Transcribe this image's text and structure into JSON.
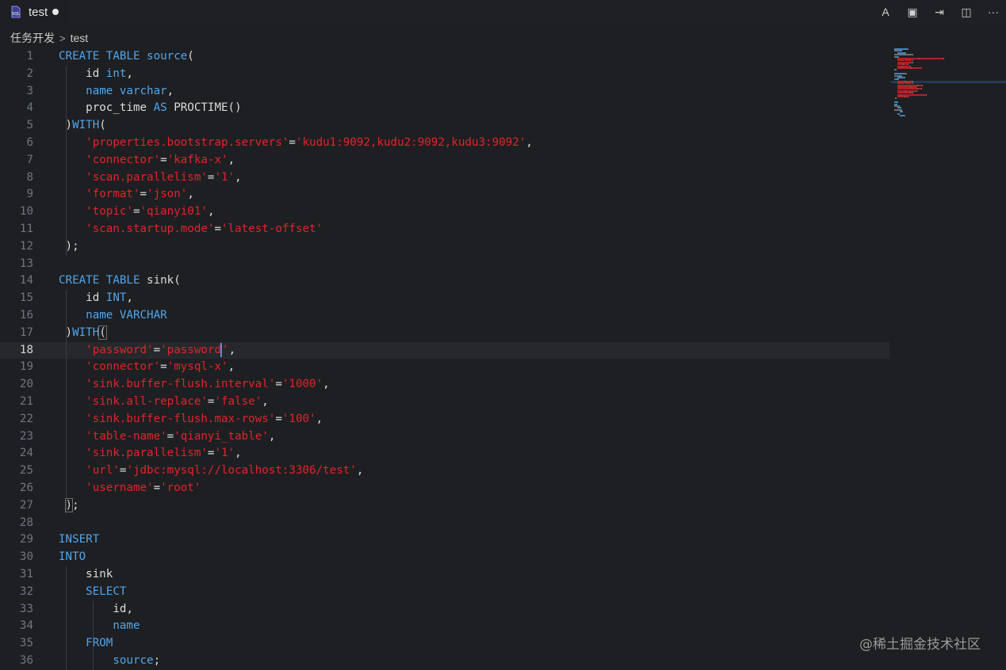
{
  "tab": {
    "title": "test",
    "icon": "sql-file-icon",
    "dirty": true
  },
  "toolbar": {
    "actions": [
      {
        "name": "spell-check-icon",
        "glyph": "A"
      },
      {
        "name": "save-icon",
        "glyph": "▣"
      },
      {
        "name": "submit-icon",
        "glyph": "⇥"
      },
      {
        "name": "split-editor-icon",
        "glyph": "◫"
      },
      {
        "name": "more-icon",
        "glyph": "···"
      }
    ]
  },
  "breadcrumb": {
    "root": "任务开发",
    "separator": ">",
    "current": "test"
  },
  "editor": {
    "current_line": 18,
    "lines": [
      [
        [
          "kw",
          "CREATE TABLE source"
        ],
        [
          "txt",
          "("
        ]
      ],
      [
        [
          "txt",
          "    id "
        ],
        [
          "kw",
          "int"
        ],
        [
          "txt",
          ","
        ]
      ],
      [
        [
          "txt",
          "    "
        ],
        [
          "kw",
          "name varchar"
        ],
        [
          "txt",
          ","
        ]
      ],
      [
        [
          "txt",
          "    proc_time "
        ],
        [
          "kw",
          "AS"
        ],
        [
          "txt",
          " PROCTIME()"
        ]
      ],
      [
        [
          "txt",
          " )"
        ],
        [
          "kw",
          "WITH"
        ],
        [
          "txt",
          "("
        ]
      ],
      [
        [
          "txt",
          "    "
        ],
        [
          "str",
          "'properties.bootstrap.servers'"
        ],
        [
          "txt",
          "="
        ],
        [
          "str",
          "'kudu1:9092,kudu2:9092,kudu3:9092'"
        ],
        [
          "txt",
          ","
        ]
      ],
      [
        [
          "txt",
          "    "
        ],
        [
          "str",
          "'connector'"
        ],
        [
          "txt",
          "="
        ],
        [
          "str",
          "'kafka-x'"
        ],
        [
          "txt",
          ","
        ]
      ],
      [
        [
          "txt",
          "    "
        ],
        [
          "str",
          "'scan.parallelism'"
        ],
        [
          "txt",
          "="
        ],
        [
          "str",
          "'1'"
        ],
        [
          "txt",
          ","
        ]
      ],
      [
        [
          "txt",
          "    "
        ],
        [
          "str",
          "'format'"
        ],
        [
          "txt",
          "="
        ],
        [
          "str",
          "'json'"
        ],
        [
          "txt",
          ","
        ]
      ],
      [
        [
          "txt",
          "    "
        ],
        [
          "str",
          "'topic'"
        ],
        [
          "txt",
          "="
        ],
        [
          "str",
          "'qianyi01'"
        ],
        [
          "txt",
          ","
        ]
      ],
      [
        [
          "txt",
          "    "
        ],
        [
          "str",
          "'scan.startup.mode'"
        ],
        [
          "txt",
          "="
        ],
        [
          "str",
          "'latest-offset'"
        ]
      ],
      [
        [
          "txt",
          " );"
        ]
      ],
      [],
      [
        [
          "kw",
          "CREATE TABLE"
        ],
        [
          "txt",
          " sink("
        ]
      ],
      [
        [
          "txt",
          "    id "
        ],
        [
          "kw",
          "INT"
        ],
        [
          "txt",
          ","
        ]
      ],
      [
        [
          "txt",
          "    "
        ],
        [
          "kw",
          "name VARCHAR"
        ]
      ],
      [
        [
          "txt",
          " )"
        ],
        [
          "kw",
          "WITH"
        ],
        [
          "brk",
          "("
        ]
      ],
      [
        [
          "txt",
          "    "
        ],
        [
          "str",
          "'password'"
        ],
        [
          "txt",
          "="
        ],
        [
          "str",
          "'password"
        ],
        [
          "cur",
          ""
        ],
        [
          "str",
          "'"
        ],
        [
          "txt",
          ","
        ]
      ],
      [
        [
          "txt",
          "    "
        ],
        [
          "str",
          "'connector'"
        ],
        [
          "txt",
          "="
        ],
        [
          "str",
          "'mysql-x'"
        ],
        [
          "txt",
          ","
        ]
      ],
      [
        [
          "txt",
          "    "
        ],
        [
          "str",
          "'sink.buffer-flush.interval'"
        ],
        [
          "txt",
          "="
        ],
        [
          "str",
          "'1000'"
        ],
        [
          "txt",
          ","
        ]
      ],
      [
        [
          "txt",
          "    "
        ],
        [
          "str",
          "'sink.all-replace'"
        ],
        [
          "txt",
          "="
        ],
        [
          "str",
          "'false'"
        ],
        [
          "txt",
          ","
        ]
      ],
      [
        [
          "txt",
          "    "
        ],
        [
          "str",
          "'sink.buffer-flush.max-rows'"
        ],
        [
          "txt",
          "="
        ],
        [
          "str",
          "'100'"
        ],
        [
          "txt",
          ","
        ]
      ],
      [
        [
          "txt",
          "    "
        ],
        [
          "str",
          "'table-name'"
        ],
        [
          "txt",
          "="
        ],
        [
          "str",
          "'qianyi_table'"
        ],
        [
          "txt",
          ","
        ]
      ],
      [
        [
          "txt",
          "    "
        ],
        [
          "str",
          "'sink.parallelism'"
        ],
        [
          "txt",
          "="
        ],
        [
          "str",
          "'1'"
        ],
        [
          "txt",
          ","
        ]
      ],
      [
        [
          "txt",
          "    "
        ],
        [
          "str",
          "'url'"
        ],
        [
          "txt",
          "="
        ],
        [
          "str",
          "'jdbc:mysql://localhost:3306/test'"
        ],
        [
          "txt",
          ","
        ]
      ],
      [
        [
          "txt",
          "    "
        ],
        [
          "str",
          "'username'"
        ],
        [
          "txt",
          "="
        ],
        [
          "str",
          "'root'"
        ]
      ],
      [
        [
          "txt",
          " "
        ],
        [
          "brk",
          ")"
        ],
        [
          "txt",
          ";"
        ]
      ],
      [],
      [
        [
          "kw",
          "INSERT"
        ]
      ],
      [
        [
          "kw",
          "INTO"
        ]
      ],
      [
        [
          "txt",
          "    sink"
        ]
      ],
      [
        [
          "txt",
          "    "
        ],
        [
          "kw",
          "SELECT"
        ]
      ],
      [
        [
          "txt",
          "        id,"
        ]
      ],
      [
        [
          "txt",
          "        "
        ],
        [
          "kw",
          "name"
        ]
      ],
      [
        [
          "txt",
          "    "
        ],
        [
          "kw",
          "FROM"
        ]
      ],
      [
        [
          "txt",
          "        "
        ],
        [
          "kw",
          "source"
        ],
        [
          "txt",
          ";"
        ]
      ]
    ]
  },
  "watermark": "@稀土掘金技术社区",
  "colors": {
    "keyword": "#4fa6ee",
    "string": "#e3232b",
    "text": "#dcdcdc",
    "background": "#1e1f22"
  }
}
